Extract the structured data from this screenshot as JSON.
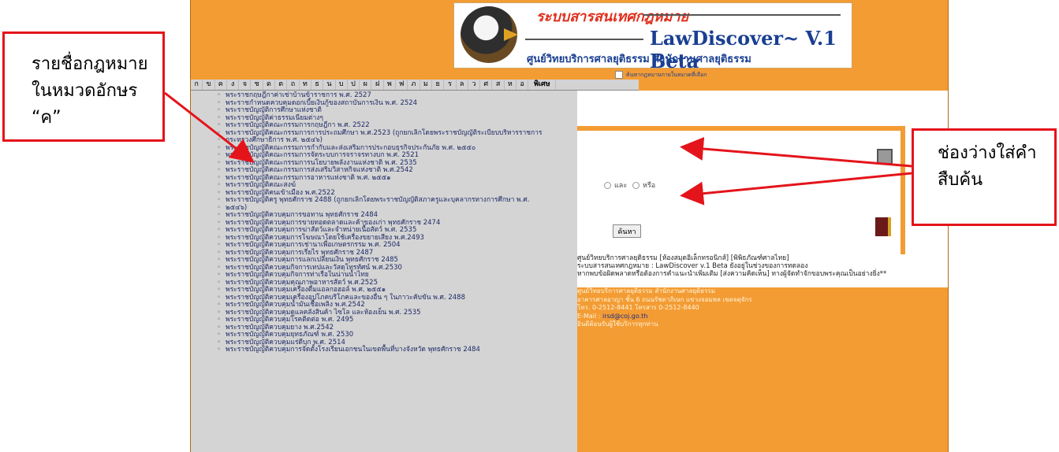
{
  "banner": {
    "top_text": "ระบบสารสนเทศกฎหมาย",
    "title": "LawDiscover~ V.1 Beta",
    "subtitle": "ศูนย์วิทยบริการศาลยุติธรรม  สำนักงานศาลยุติธรรม",
    "checkbox_label": "ค้นหากฎหมายภายในหมวดที่เลือก"
  },
  "letters": [
    "ก",
    "ข",
    "ค",
    "ง",
    "จ",
    "ช",
    "ด",
    "ต",
    "ถ",
    "ท",
    "ธ",
    "น",
    "บ",
    "ป",
    "ผ",
    "ฝ",
    "พ",
    "ฟ",
    "ภ",
    "ม",
    "ย",
    "ร",
    "ล",
    "ว",
    "ศ",
    "ส",
    "ห",
    "อ"
  ],
  "letters_extra": "พิเศษ",
  "laws": [
    "พระราชกฤษฎีกาค่าเช่าบ้านข้าราชการ พ.ศ. 2527",
    "พระราชกำหนดควบคุมดอกเบี้ยเงินกู้ของสถาบันการเงิน พ.ศ. 2524",
    "พระราชบัญญัติการศึกษาแห่งชาติ",
    "พระราชบัญญัติค่าธรรมเนียมต่างๆ",
    "พระราชบัญญัติคณะกรรมการกฤษฎีกา พ.ศ. 2522",
    "พระราชบัญญัติคณะกรรมการการประถมศึกษา พ.ศ.2523 (ถูกยกเลิกโดยพระราชบัญญัติระเบียบบริหารราชการ",
    "กระทรวงศึกษาธิการ พ.ศ. ๒๕๔๖)",
    "พระราชบัญญัติคณะกรรมการกำกับและส่งเสริมการประกอบธุรกิจประกันภัย พ.ศ. ๒๕๕๐",
    "พระราชบัญญัติคณะกรรมการจัดระบบการจราจรทางบก พ.ศ. 2521",
    "พระราชบัญญัติคณะกรรมการนโยบายพลังงานแห่งชาติ พ.ศ. 2535",
    "พระราชบัญญัติคณะกรรมการส่งเสริมวิสาหกิจแห่งชาติ พ.ศ.2542",
    "พระราชบัญญัติคณะกรรมการอาหารแห่งชาติ พ.ศ. ๒๕๕๑",
    "พระราชบัญญัติคณะสงฆ์",
    "พระราชบัญญัติคนเข้าเมือง พ.ศ.2522",
    "พระราชบัญญัติครู พุทธศักราช 2488 (ถูกยกเลิกโดยพระราชบัญญัติสภาครูและบุคลากรทางการศึกษา พ.ศ.",
    "๒๕๔๖)",
    "พระราชบัญญัติควบคุมการขอทาน พุทธศักราช 2484",
    "พระราชบัญญัติควบคุมการขายทอดตลาดและค้าของเก่า พุทธศักราช 2474",
    "พระราชบัญญัติควบคุมการฆ่าสัตว์และจำหน่ายเนื้อสัตว์ พ.ศ. 2535",
    "พระราชบัญญัติควบคุมการโฆษณาโดยใช้เครื่องขยายเสียง พ.ศ.2493",
    "พระราชบัญญัติควบคุมการเช่านาเพื่อเกษตรกรรม พ.ศ. 2504",
    "พระราชบัญญัติควบคุมการเรี่ยไร พุทธศักราช 2487",
    "พระราชบัญญัติควบคุมการแลกเปลี่ยนเงิน พุทธศักราช 2485",
    "พระราชบัญญัติควบคุมกิจการเทปและวัสดุโทรทัศน์ พ.ศ.2530",
    "พระราชบัญญัติควบคุมกิจการท่าเรือในน่านน้ำไทย",
    "พระราชบัญญัติควบคุมคุณภาพอาหารสัตว์ พ.ศ.2525",
    "พระราชบัญญัติควบคุมเครื่องดื่มแอลกอฮอล์ พ.ศ. ๒๕๕๑",
    "พระราชบัญญัติควบคุมเครื่องอุปโภคบริโภคและของอื่น ๆ ในภาวะคับขัน พ.ศ. 2488",
    "พระราชบัญญัติควบคุมน้ำมันเชื้อเพลิง พ.ศ.2542",
    "พระราชบัญญัติควบคุมดูแลคลังสินค้า ไซโล และห้องเย็น พ.ศ. 2535",
    "พระราชบัญญัติควบคุมโรคติดต่อ พ.ศ. 2495",
    "พระราชบัญญัติควบคุมยาง พ.ศ.2542",
    "พระราชบัญญัติควบคุมยุทธภัณฑ์ พ.ศ. 2530",
    "พระราชบัญญัติควบคุมแร่ดีบุก พ.ศ. 2514",
    "พระราชบัญญัติควบคุมการจัดตั้งโรงเรียนเอกชนในเขตพื้นที่บางจังหวัด พุทธศักราช 2484"
  ],
  "search": {
    "and_label": "และ",
    "or_label": "หรือ",
    "button_label": "ค้นหา"
  },
  "footer": {
    "line1": "ศูนย์วิทยบริการศาลยุติธรรม [ห้องสมุดอิเล็กทรอนิกส์] [พิพิธภัณฑ์ศาลไทย]",
    "line2": "ระบบสารสนเทศกฎหมาย : LawDiscover v.1 Beta  ยังอยู่ในช่วงของการทดลอง",
    "line3": "หากพบข้อผิดพลาดหรือต้องการคำแนะนำเพิ่มเติม [ส่งความคิดเห็น] ทางผู้จัดทำจักขอบพระคุณเป็นอย่างยิ่ง**",
    "address1": "ศูนย์วิทยบริการศาลยุติธรรม สำนักงานศาลยุติธรรม",
    "address2": "อาคารศาลอาญา ชั้น 6 ถนนรัชดาภิเษก แขวงจอมพล เขตจตุจักร",
    "phone": "โทร. 0-2512-8441 โทรสาร 0-2512-8440",
    "email_label": "E-Mail :",
    "email": "irsd@coj.go.th",
    "note": "ยินดีต้อนรับผู้ใช้บริการทุกท่าน"
  },
  "annotations": {
    "left_line1": "รายชื่อกฎหมาย",
    "left_line2": "ในหมวดอักษร",
    "left_line3": "“ค”",
    "right_line1": "ช่องว่างใส่คำ",
    "right_line2": "สืบค้น"
  }
}
